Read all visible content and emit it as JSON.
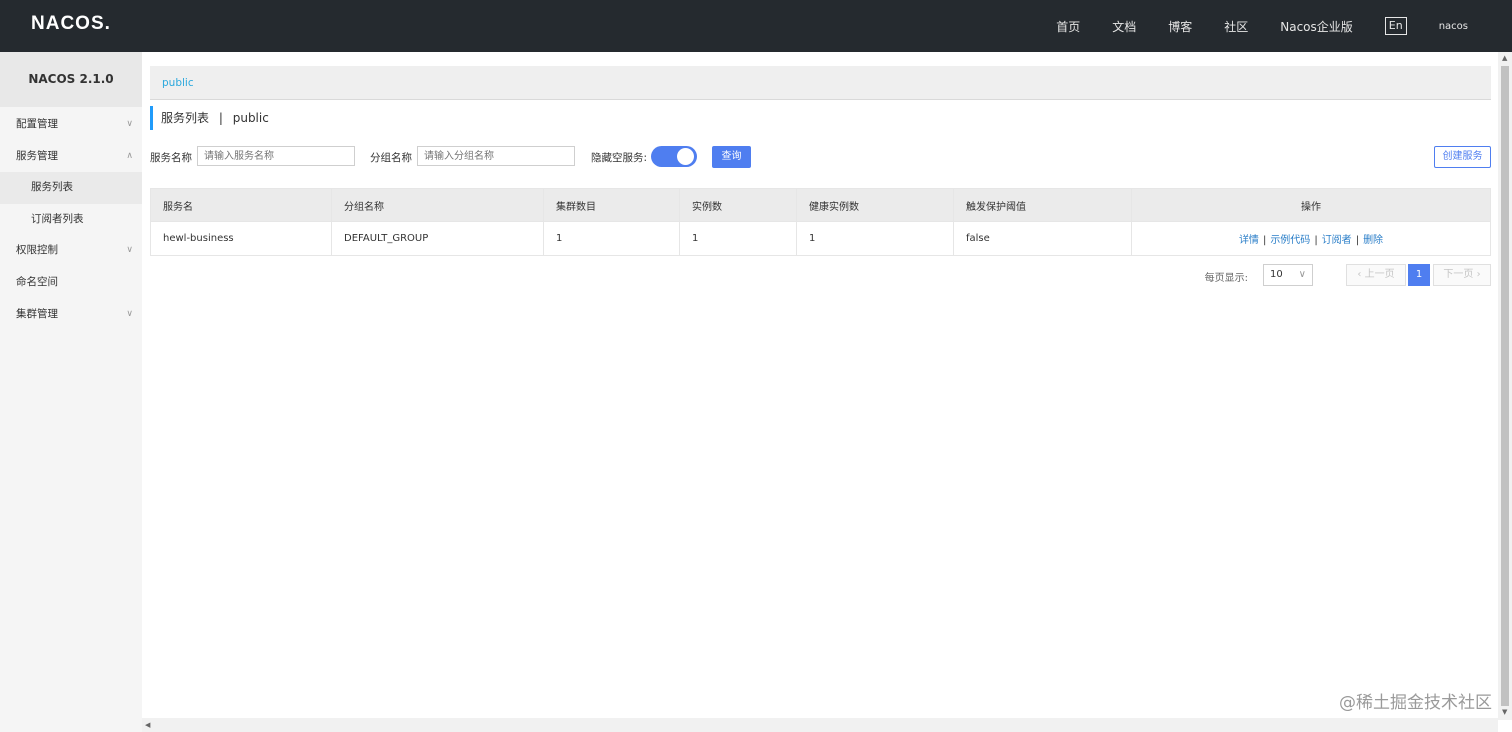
{
  "header": {
    "logo": "NACOS.",
    "nav": [
      "首页",
      "文档",
      "博客",
      "社区",
      "Nacos企业版"
    ],
    "lang": "En",
    "user": "nacos"
  },
  "sidebar": {
    "version": "NACOS 2.1.0",
    "items": [
      {
        "label": "配置管理"
      },
      {
        "label": "服务管理"
      },
      {
        "label": "服务列表"
      },
      {
        "label": "订阅者列表"
      },
      {
        "label": "权限控制"
      },
      {
        "label": "命名空间"
      },
      {
        "label": "集群管理"
      }
    ]
  },
  "namespace_tab": "public",
  "page_title": "服务列表",
  "page_title_sep": "|",
  "page_namespace": "public",
  "search": {
    "service_label": "服务名称",
    "service_placeholder": "请输入服务名称",
    "group_label": "分组名称",
    "group_placeholder": "请输入分组名称",
    "hide_empty_label": "隐藏空服务:",
    "hide_empty_on": true,
    "query_button": "查询",
    "create_button": "创建服务"
  },
  "table": {
    "headers": [
      "服务名",
      "分组名称",
      "集群数目",
      "实例数",
      "健康实例数",
      "触发保护阈值",
      "操作"
    ],
    "rows": [
      {
        "cells": [
          "hewl-business",
          "DEFAULT_GROUP",
          "1",
          "1",
          "1",
          "false"
        ]
      }
    ],
    "actions": [
      "详情",
      "示例代码",
      "订阅者",
      "删除"
    ],
    "action_sep": "|"
  },
  "pagination": {
    "page_size_label": "每页显示:",
    "page_size": "10",
    "prev": "上一页",
    "current": "1",
    "next": "下一页"
  },
  "watermark": "@稀土掘金技术社区"
}
